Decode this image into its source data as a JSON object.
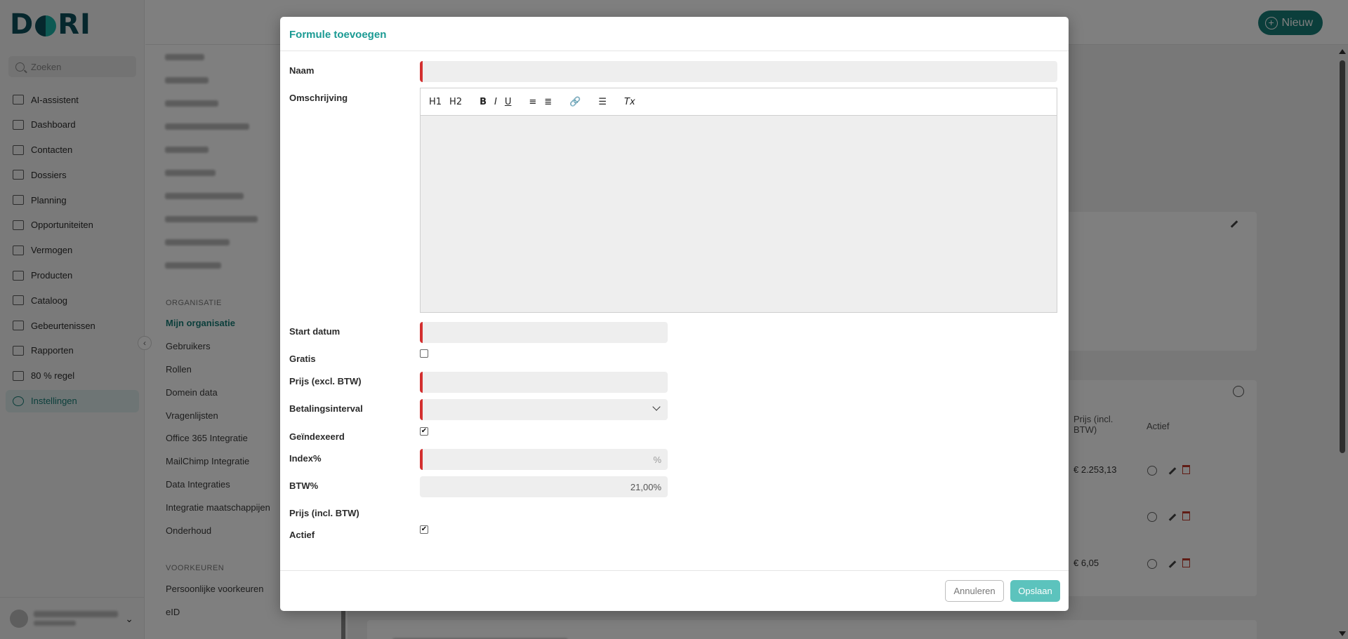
{
  "app": {
    "logo_text": "DORI",
    "new_button": "Nieuw",
    "search_placeholder": "Zoeken",
    "nav": [
      {
        "label": "AI-assistent",
        "icon": "sparkle-icon"
      },
      {
        "label": "Dashboard",
        "icon": "grid-icon"
      },
      {
        "label": "Contacten",
        "icon": "contacts-icon"
      },
      {
        "label": "Dossiers",
        "icon": "folder-icon"
      },
      {
        "label": "Planning",
        "icon": "calendar-icon"
      },
      {
        "label": "Opportuniteiten",
        "icon": "bulb-icon"
      },
      {
        "label": "Vermogen",
        "icon": "chart-icon"
      },
      {
        "label": "Producten",
        "icon": "wallet-icon"
      },
      {
        "label": "Cataloog",
        "icon": "catalog-icon"
      },
      {
        "label": "Gebeurtenissen",
        "icon": "table-icon"
      },
      {
        "label": "Rapporten",
        "icon": "report-icon"
      },
      {
        "label": "80 % regel",
        "icon": "hand-icon"
      },
      {
        "label": "Instellingen",
        "icon": "gear-icon",
        "active": true
      }
    ],
    "settings_menu": {
      "section_org": "ORGANISATIE",
      "org_links": [
        "Mijn organisatie",
        "Gebruikers",
        "Rollen",
        "Domein data",
        "Vragenlijsten",
        "Office 365 Integratie",
        "MailChimp Integratie",
        "Data Integraties",
        "Integratie maatschappijen",
        "Onderhoud"
      ],
      "section_prefs": "VOORKEUREN",
      "pref_links": [
        "Persoonlijke voorkeuren",
        "eID"
      ]
    },
    "background_table": {
      "headers": [
        "Prijs (incl. BTW)",
        "Actief"
      ],
      "rows": [
        {
          "price": "€ 2.253,13"
        },
        {
          "price": ""
        },
        {
          "price": "€ 6,05"
        }
      ]
    }
  },
  "modal": {
    "title": "Formule toevoegen",
    "fields": {
      "naam": {
        "label": "Naam",
        "value": ""
      },
      "omschrijving": {
        "label": "Omschrijving"
      },
      "start_datum": {
        "label": "Start datum",
        "value": ""
      },
      "gratis": {
        "label": "Gratis",
        "checked": false
      },
      "prijs_excl": {
        "label": "Prijs (excl. BTW)",
        "value": ""
      },
      "betalingsinterval": {
        "label": "Betalingsinterval",
        "value": ""
      },
      "geindexeerd": {
        "label": "Geïndexeerd",
        "checked": true
      },
      "index": {
        "label": "Index%",
        "value": "%"
      },
      "btw": {
        "label": "BTW%",
        "value": "21,00%"
      },
      "prijs_incl": {
        "label": "Prijs (incl. BTW)",
        "value": ""
      },
      "actief": {
        "label": "Actief",
        "checked": true
      }
    },
    "toolbar": {
      "h1": "H1",
      "h2": "H2",
      "bold": "B",
      "italic": "I",
      "underline": "U",
      "ordered_list": "≡",
      "bullet_list": "≣",
      "link": "🔗",
      "align": "☰",
      "clear": "Tx"
    },
    "buttons": {
      "cancel": "Annuleren",
      "save": "Opslaan"
    }
  }
}
